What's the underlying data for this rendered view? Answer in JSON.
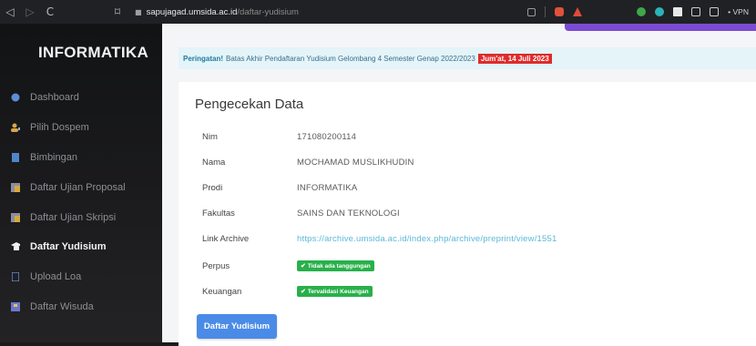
{
  "browser": {
    "url_domain": "sapujagad.umsida.ac.id",
    "url_path": "/daftar-yudisium",
    "vpn_label": "• VPN"
  },
  "sidebar": {
    "brand": "INFORMATIKA",
    "items": [
      {
        "label": "Dashboard",
        "icon": "info-icon"
      },
      {
        "label": "Pilih Dospem",
        "icon": "user-icon"
      },
      {
        "label": "Bimbingan",
        "icon": "document-icon"
      },
      {
        "label": "Daftar Ujian Proposal",
        "icon": "folder-icon"
      },
      {
        "label": "Daftar Ujian Skripsi",
        "icon": "folder-icon"
      },
      {
        "label": "Daftar Yudisium",
        "icon": "graduation-cap-icon",
        "active": true
      },
      {
        "label": "Upload Loa",
        "icon": "file-icon"
      },
      {
        "label": "Daftar Wisuda",
        "icon": "graduation-icon"
      }
    ]
  },
  "alert": {
    "prefix": "Peringatan!",
    "message": "Batas Akhir Pendaftaran Yudisium Gelombang 4 Semester Genap 2022/2023",
    "deadline": "Jum'at, 14 Juli 2023"
  },
  "card": {
    "title": "Pengecekan Data",
    "fields": [
      {
        "label": "Nim",
        "value": "171080200114"
      },
      {
        "label": "Nama",
        "value": "MOCHAMAD MUSLIKHUDIN"
      },
      {
        "label": "Prodi",
        "value": "INFORMATIKA"
      },
      {
        "label": "Fakultas",
        "value": "SAINS DAN TEKNOLOGI"
      },
      {
        "label": "Link Archive",
        "value": "https://archive.umsida.ac.id/index.php/archive/preprint/view/1551"
      },
      {
        "label": "Perpus",
        "value": "Tidak ada tanggungan"
      },
      {
        "label": "Keuangan",
        "value": "Tervalidasi Keuangan"
      }
    ],
    "submit_label": "Daftar Yudisium"
  },
  "colors": {
    "sidebar_bg": "#1b1b1d",
    "accent_purple": "#7b4bd2",
    "badge_green": "#28b04a",
    "button_blue": "#4a8be8",
    "alert_red": "#e02b2b"
  }
}
